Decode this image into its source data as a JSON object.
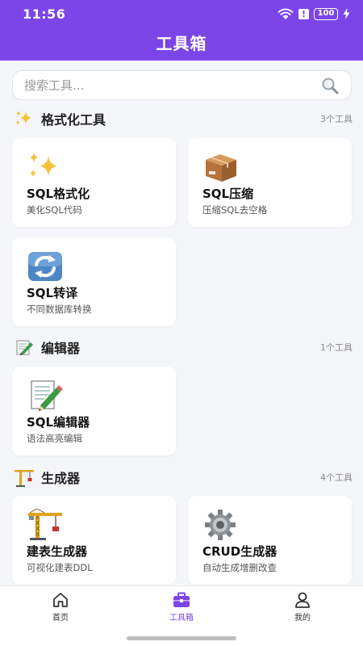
{
  "status_bar": {
    "time": "11:56",
    "battery": "100",
    "alert": "!"
  },
  "header": {
    "title": "工具箱"
  },
  "search": {
    "placeholder": "搜索工具..."
  },
  "sections": [
    {
      "icon": "sparkles-icon",
      "title": "格式化工具",
      "count": "3个工具",
      "tools": [
        {
          "title": "SQL格式化",
          "desc": "美化SQL代码",
          "icon": "sparkles-icon"
        },
        {
          "title": "SQL压缩",
          "desc": "压缩SQL去空格",
          "icon": "package-box-icon"
        },
        {
          "title": "SQL转译",
          "desc": "不同数据库转换",
          "icon": "refresh-arrows-icon"
        }
      ]
    },
    {
      "icon": "memo-pencil-icon",
      "title": "编辑器",
      "count": "1个工具",
      "tools": [
        {
          "title": "SQL编辑器",
          "desc": "语法高亮编辑",
          "icon": "memo-pencil-icon"
        }
      ]
    },
    {
      "icon": "construction-crane-icon",
      "title": "生成器",
      "count": "4个工具",
      "tools": [
        {
          "title": "建表生成器",
          "desc": "可视化建表DDL",
          "icon": "construction-crane-icon"
        },
        {
          "title": "CRUD生成器",
          "desc": "自动生成增删改查",
          "icon": "gear-icon"
        }
      ]
    }
  ],
  "nav": {
    "active": "tools",
    "items": [
      {
        "id": "home",
        "label": "首页",
        "icon": "home-icon"
      },
      {
        "id": "tools",
        "label": "工具箱",
        "icon": "toolbox-icon"
      },
      {
        "id": "mine",
        "label": "我的",
        "icon": "user-icon"
      }
    ]
  },
  "colors": {
    "accent": "#7b45e8",
    "background": "#f5f6fa",
    "card": "#ffffff"
  }
}
